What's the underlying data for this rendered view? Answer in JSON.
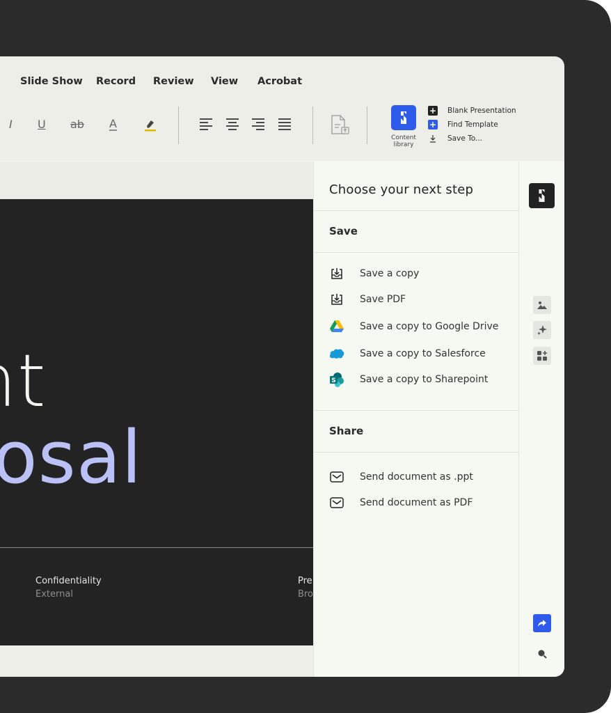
{
  "menu": {
    "items": [
      "Slide Show",
      "Record",
      "Review",
      "View",
      "Acrobat"
    ]
  },
  "toolbar": {
    "italic": "I",
    "underline": "U",
    "strikethrough": "ab",
    "font_color": "A",
    "content_library_label": "Content library",
    "quick_actions": [
      "Blank Presentation",
      "Find Template",
      "Save To..."
    ]
  },
  "slide": {
    "line1": "nt",
    "line2": "osal",
    "confidentiality_label": "Confidentiality",
    "confidentiality_value": "External",
    "right_label": "Pre",
    "right_value": "Bro"
  },
  "panel": {
    "title": "Choose your next step",
    "save_section": {
      "title": "Save",
      "actions": [
        {
          "label": "Save a copy",
          "icon": "download-tray-icon"
        },
        {
          "label": "Save PDF",
          "icon": "download-tray-icon"
        },
        {
          "label": "Save a copy to Google Drive",
          "icon": "google-drive-icon"
        },
        {
          "label": "Save a copy to Salesforce",
          "icon": "salesforce-icon"
        },
        {
          "label": "Save a copy to Sharepoint",
          "icon": "sharepoint-icon"
        }
      ]
    },
    "share_section": {
      "title": "Share",
      "actions": [
        {
          "label": "Send document as .ppt",
          "icon": "mail-icon"
        },
        {
          "label": "Send document as PDF",
          "icon": "mail-icon"
        }
      ]
    }
  },
  "colors": {
    "accent": "#2f5bea",
    "slide_bg": "#232323",
    "slide_accent_text": "#b9c1f6"
  }
}
